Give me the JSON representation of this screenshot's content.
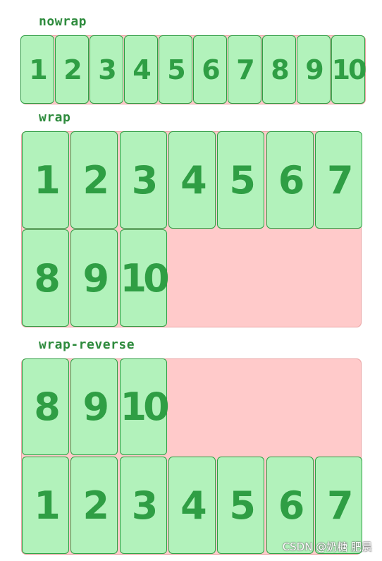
{
  "sections": {
    "nowrap": {
      "label": "nowrap",
      "items": [
        "1",
        "2",
        "3",
        "4",
        "5",
        "6",
        "7",
        "8",
        "9",
        "10"
      ]
    },
    "wrap": {
      "label": "wrap",
      "row1": [
        "1",
        "2",
        "3",
        "4",
        "5",
        "6",
        "7"
      ],
      "row2": [
        "8",
        "9",
        "10"
      ]
    },
    "wrap_reverse": {
      "label": "wrap-reverse",
      "row1": [
        "8",
        "9",
        "10"
      ],
      "row2": [
        "1",
        "2",
        "3",
        "4",
        "5",
        "6",
        "7"
      ]
    }
  },
  "watermark": "CSDN @奶糖 肥晨",
  "colors": {
    "container_fill": "#ffcaca",
    "item_fill": "#b2f2bb",
    "item_stroke": "#2f9e44"
  }
}
